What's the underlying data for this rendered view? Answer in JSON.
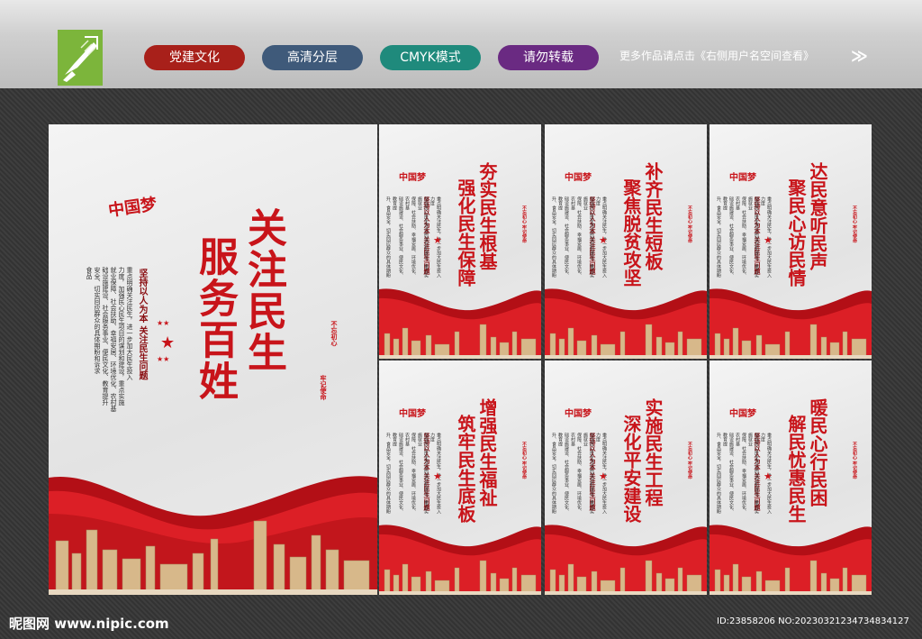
{
  "header": {
    "pills": [
      {
        "label": "党建文化",
        "color": "#a8201a"
      },
      {
        "label": "高清分层",
        "color": "#3f5a7a"
      },
      {
        "label": "CMYK模式",
        "color": "#1f8a7c"
      },
      {
        "label": "请勿转载",
        "color": "#6a2a82"
      }
    ],
    "hint": "更多作品请点击《右侧用户名空间查看》",
    "chevron": "≫"
  },
  "main_poster": {
    "title_line1": "关注民生",
    "title_line2": "服务百姓",
    "subtitle": "坚持以人为本  关注民生问题",
    "body_lines": [
      "重点明确关注民生，进一步加大民生投入",
      "力度，加强民心民生项目的谋划和建设，重点实施",
      "就业保障、社会扶助、幸福安居、环境优化、农村基",
      "础设施建设、社会服务事业、便民文化、教育提升",
      "安全、切实回应群众的具体期盼和诉求",
      "食品"
    ],
    "seal_left": "不忘初心",
    "seal_right": "牢记使命",
    "mark": "中国梦"
  },
  "panels": [
    {
      "line1": "夯实民生根基",
      "line2": "强化民生保障"
    },
    {
      "line1": "补齐民生短板",
      "line2": "聚焦脱贫攻坚"
    },
    {
      "line1": "达民意听民声",
      "line2": "聚民心访民情"
    },
    {
      "line1": "增强民生福祉",
      "line2": "筑牢民生底板"
    },
    {
      "line1": "实施民生工程",
      "line2": "深化平安建设"
    },
    {
      "line1": "暖民心行民困",
      "line2": "解民忧惠民生"
    }
  ],
  "panel_common": {
    "subtitle": "坚持以人为本  关注民生问题",
    "seal": "不忘初心 牢记使命",
    "body_lines": [
      "重点明确关注民生，进一步加大民生投入力度",
      "加强民心民生项目的谋划和建设，重点实施就业",
      "保障、社会扶助、幸福安居、环境优化、农村基",
      "础设施建设、社会服务事业、便民文化、教育提",
      "升、食品安全，切实回应群众的具体期盼"
    ]
  },
  "footer": {
    "site": "昵图网 www.nipic.com",
    "id": "ID:23858206 NO:20230321234734834127"
  }
}
